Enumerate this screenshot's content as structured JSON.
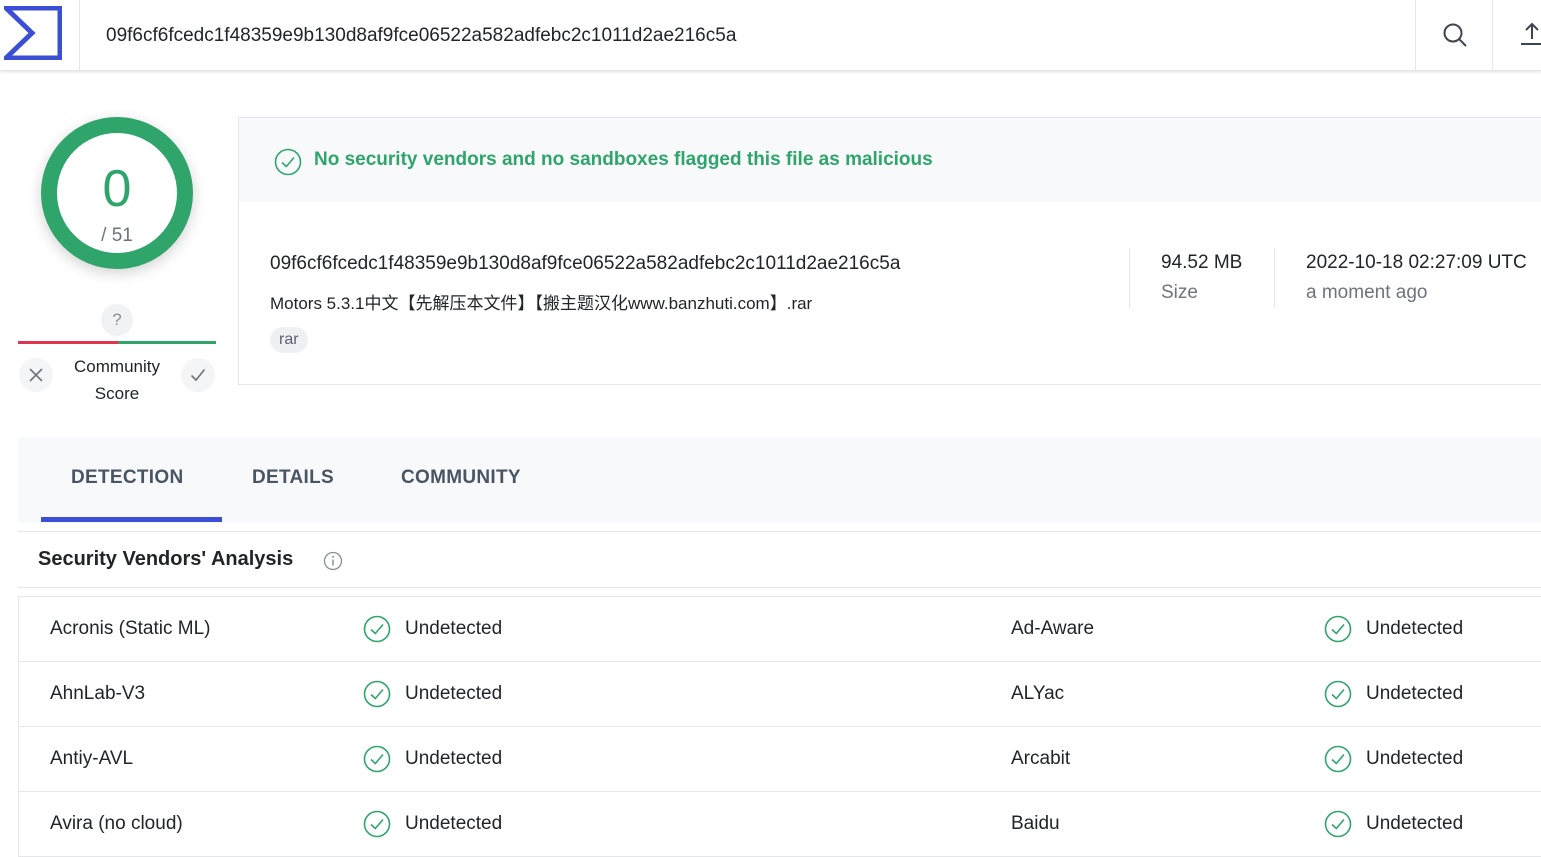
{
  "header": {
    "search_value": "09f6cf6fcedc1f48359e9b130d8af9fce06522a582adfebc2c1011d2ae216c5a",
    "icons": {
      "logo": "virustotal-sigma-logo",
      "search": "search-icon",
      "upload": "upload-icon"
    },
    "colors": {
      "logo": "#3a4fd6"
    }
  },
  "score": {
    "detections": "0",
    "total": "/ 51",
    "ring_color": "#2fa56c"
  },
  "community": {
    "question": "?",
    "label": "Community Score",
    "colors": {
      "negative": "#e0344f",
      "positive": "#2fa56c"
    }
  },
  "summary": {
    "alert_text": "No security vendors and no sandboxes flagged this file as malicious",
    "hash": "09f6cf6fcedc1f48359e9b130d8af9fce06522a582adfebc2c1011d2ae216c5a",
    "file_name": "Motors 5.3.1中文【先解压本文件】【搬主题汉化www.banzhuti.com】.rar",
    "tag": "rar",
    "size_value": "94.52 MB",
    "size_label": "Size",
    "date_value": "2022-10-18 02:27:09 UTC",
    "date_relative": "a moment ago"
  },
  "tabs": [
    {
      "label": "DETECTION",
      "active": true
    },
    {
      "label": "DETAILS",
      "active": false
    },
    {
      "label": "COMMUNITY",
      "active": false
    }
  ],
  "vendors": {
    "title": "Security Vendors' Analysis",
    "rows": [
      {
        "left_name": "Acronis (Static ML)",
        "left_result": "Undetected",
        "right_name": "Ad-Aware",
        "right_result": "Undetected"
      },
      {
        "left_name": "AhnLab-V3",
        "left_result": "Undetected",
        "right_name": "ALYac",
        "right_result": "Undetected"
      },
      {
        "left_name": "Antiy-AVL",
        "left_result": "Undetected",
        "right_name": "Arcabit",
        "right_result": "Undetected"
      },
      {
        "left_name": "Avira (no cloud)",
        "left_result": "Undetected",
        "right_name": "Baidu",
        "right_result": "Undetected"
      }
    ]
  }
}
